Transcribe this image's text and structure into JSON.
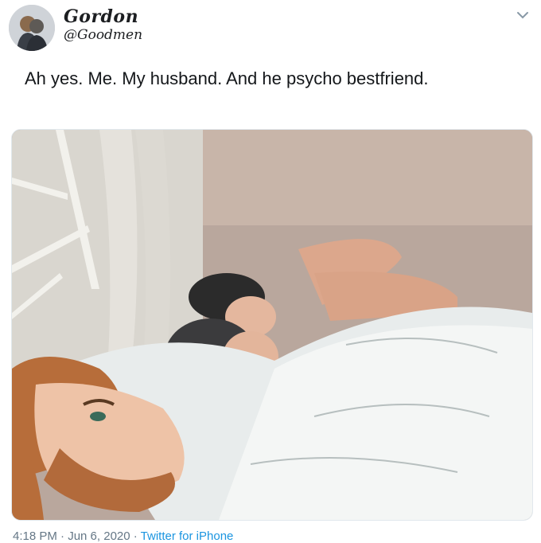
{
  "tweet": {
    "display_name": "Gordon",
    "handle": "@Goodmen",
    "text": "Ah yes. Me. My husband. And he psycho bestfriend.",
    "timestamp": "4:18 PM · Jun 6, 2020 · ",
    "source": "Twitter for iPhone"
  },
  "icons": {
    "menu": "chevron-down-icon",
    "avatar": "avatar-image"
  },
  "colors": {
    "link": "#1b95e0",
    "meta": "#657786",
    "text": "#14171a"
  }
}
